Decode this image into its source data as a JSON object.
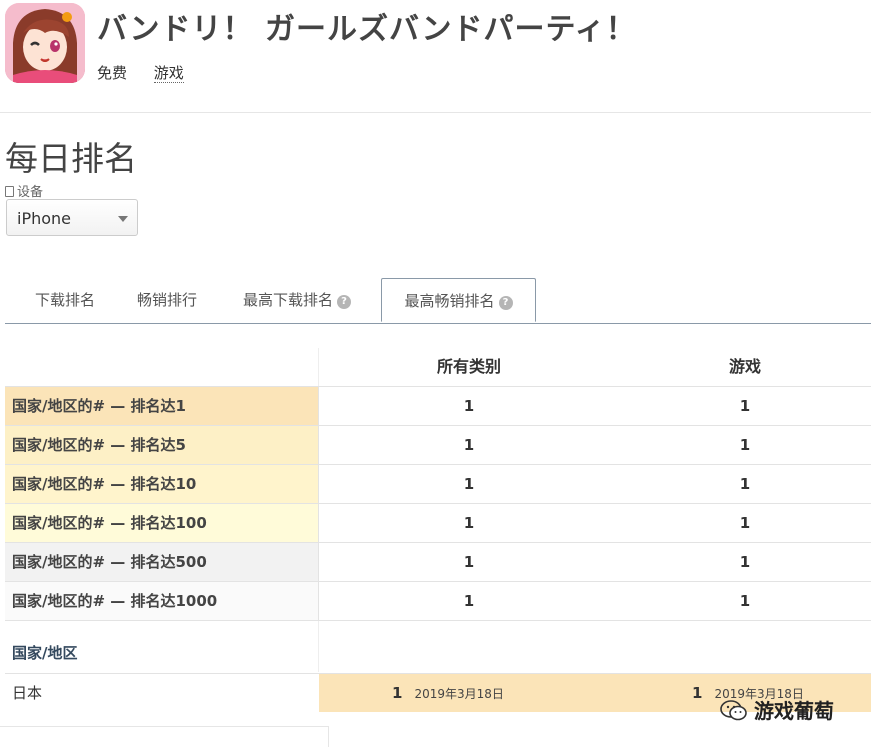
{
  "app": {
    "title": "バンドリ！ ガールズバンドパーティ！",
    "price": "免费",
    "genre": "游戏"
  },
  "section": {
    "title": "每日排名",
    "device_label": "设备",
    "device_value": "iPhone"
  },
  "tabs": [
    {
      "label": "下载排名",
      "help": false,
      "active": false
    },
    {
      "label": "畅销排行",
      "help": false,
      "active": false
    },
    {
      "label": "最高下载排名",
      "help": true,
      "active": false
    },
    {
      "label": "最高畅销排名",
      "help": true,
      "active": true
    }
  ],
  "table": {
    "columns": [
      "",
      "所有类别",
      "游戏"
    ],
    "rows": [
      {
        "label": "国家/地区的# — 排名达1",
        "all": "1",
        "game": "1"
      },
      {
        "label": "国家/地区的# — 排名达5",
        "all": "1",
        "game": "1"
      },
      {
        "label": "国家/地区的# — 排名达10",
        "all": "1",
        "game": "1"
      },
      {
        "label": "国家/地区的# — 排名达100",
        "all": "1",
        "game": "1"
      },
      {
        "label": "国家/地区的# — 排名达500",
        "all": "1",
        "game": "1"
      },
      {
        "label": "国家/地区的# — 排名达1000",
        "all": "1",
        "game": "1"
      }
    ],
    "region_header": "国家/地区",
    "countries": [
      {
        "name": "日本",
        "all_rank": "1",
        "all_date": "2019年3月18日",
        "game_rank": "1",
        "game_date": "2019年3月18日"
      }
    ]
  },
  "watermark": {
    "text": "游戏葡萄",
    "icon": "wechat-icon"
  },
  "colors": {
    "highlight": "#fbe4b8",
    "tab_border": "#8a99a8",
    "help_icon": "#b5b5b5"
  }
}
